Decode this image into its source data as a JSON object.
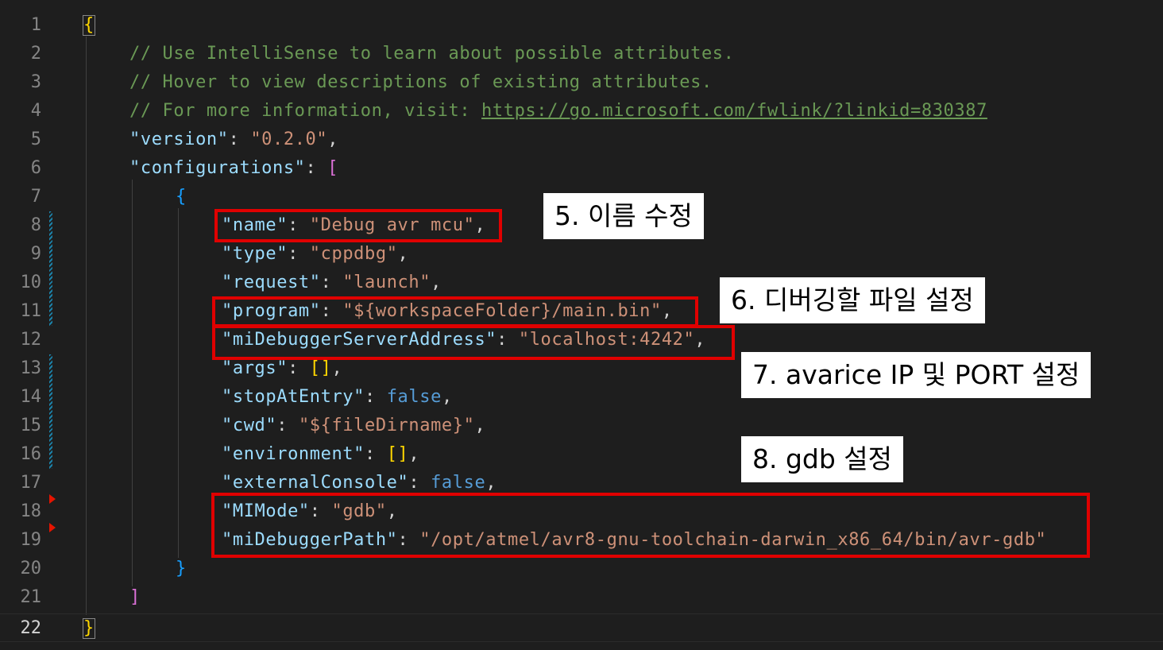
{
  "editor": {
    "active_line": "22",
    "lines": [
      {
        "n": "1",
        "brace_open": "{"
      },
      {
        "n": "2",
        "comment": "// Use IntelliSense to learn about possible attributes."
      },
      {
        "n": "3",
        "comment": "// Hover to view descriptions of existing attributes."
      },
      {
        "n": "4",
        "comment_prefix": "// For more information, visit: ",
        "link": "https://go.microsoft.com/fwlink/?linkid=830387"
      },
      {
        "n": "5",
        "key": "\"version\"",
        "sep": ": ",
        "value": "\"0.2.0\"",
        "tail": ","
      },
      {
        "n": "6",
        "key": "\"configurations\"",
        "sep": ": ",
        "bracket": "["
      },
      {
        "n": "7",
        "brace": "{"
      },
      {
        "n": "8",
        "key": "\"name\"",
        "sep": ": ",
        "value": "\"Debug avr mcu\"",
        "tail": ","
      },
      {
        "n": "9",
        "key": "\"type\"",
        "sep": ": ",
        "value": "\"cppdbg\"",
        "tail": ","
      },
      {
        "n": "10",
        "key": "\"request\"",
        "sep": ": ",
        "value": "\"launch\"",
        "tail": ","
      },
      {
        "n": "11",
        "key": "\"program\"",
        "sep": ": ",
        "value": "\"${workspaceFolder}/main.bin\"",
        "tail": ","
      },
      {
        "n": "12",
        "key": "\"miDebuggerServerAddress\"",
        "sep": ": ",
        "value": "\"localhost:4242\"",
        "tail": ","
      },
      {
        "n": "13",
        "key": "\"args\"",
        "sep": ": ",
        "bracket": "[]",
        "tail": ","
      },
      {
        "n": "14",
        "key": "\"stopAtEntry\"",
        "sep": ": ",
        "bool": "false",
        "tail": ","
      },
      {
        "n": "15",
        "key": "\"cwd\"",
        "sep": ": ",
        "value": "\"${fileDirname}\"",
        "tail": ","
      },
      {
        "n": "16",
        "key": "\"environment\"",
        "sep": ": ",
        "bracket": "[]",
        "tail": ","
      },
      {
        "n": "17",
        "key": "\"externalConsole\"",
        "sep": ": ",
        "bool": "false",
        "tail": ","
      },
      {
        "n": "18",
        "key": "\"MIMode\"",
        "sep": ": ",
        "value": "\"gdb\"",
        "tail": ","
      },
      {
        "n": "19",
        "key": "\"miDebuggerPath\"",
        "sep": ": ",
        "value": "\"/opt/atmel/avr8-gnu-toolchain-darwin_x86_64/bin/avr-gdb\""
      },
      {
        "n": "20",
        "brace": "}"
      },
      {
        "n": "21",
        "bracket": "]"
      },
      {
        "n": "22",
        "brace_close": "}"
      }
    ]
  },
  "annotations": {
    "step5": "5. 이름 수정",
    "step6": "6. 디버깅할 파일 설정",
    "step7": "7. avarice IP 및 PORT 설정",
    "step8": "8. gdb 설정"
  },
  "colors": {
    "background": "#1e1e1e",
    "highlight_box": "#e00000",
    "comment": "#6a9955",
    "key": "#9cdcfe",
    "string": "#ce9178",
    "boolean": "#569cd6"
  }
}
